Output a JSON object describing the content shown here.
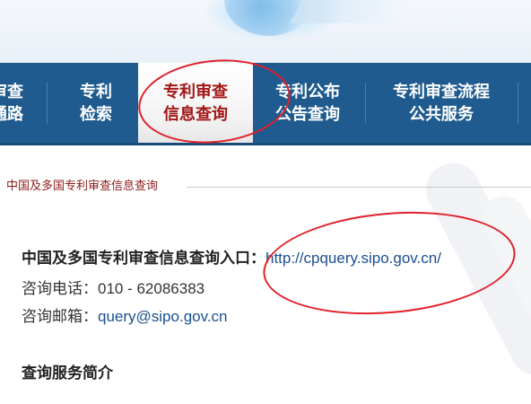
{
  "nav": {
    "items": [
      {
        "line1": "审查",
        "line2": "通路"
      },
      {
        "line1": "专利",
        "line2": "检索"
      },
      {
        "line1": "专利审查",
        "line2": "信息查询",
        "active": true
      },
      {
        "line1": "专利公布",
        "line2": "公告查询"
      },
      {
        "line1": "专利审查流程",
        "line2": "公共服务"
      }
    ]
  },
  "breadcrumb": "中国及多国专利审查信息查询",
  "content": {
    "entry_label": "中国及多国专利审查信息查询入口：",
    "entry_url": "http://cpquery.sipo.gov.cn/",
    "phone_label": "咨询电话：",
    "phone_value": "010 - 62086383",
    "email_label": "咨询邮箱：",
    "email_value": "query@sipo.gov.cn",
    "section_title": "查询服务简介"
  },
  "colors": {
    "nav_bg": "#1f5b8e",
    "active_text": "#a31616",
    "link": "#1a4f8f",
    "annotation": "#e0202a",
    "breadcrumb": "#8b1a1a"
  }
}
